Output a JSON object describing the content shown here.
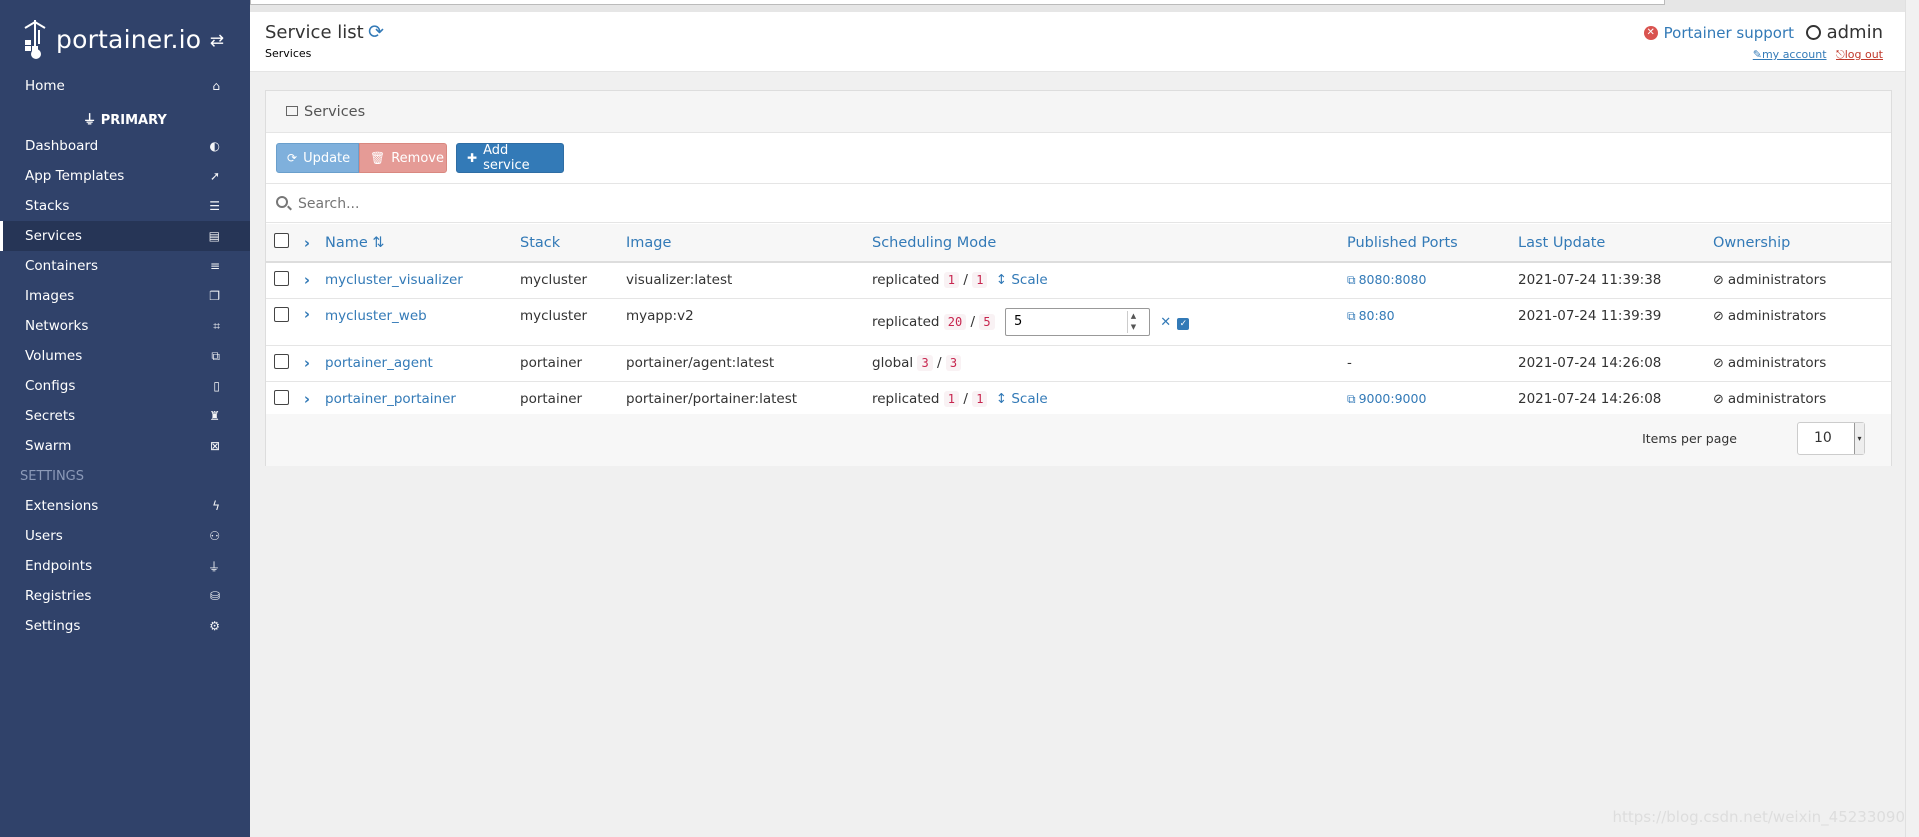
{
  "brand": {
    "name": "portainer.io"
  },
  "sidebar": {
    "home": "Home",
    "endpoint_heading": "PRIMARY",
    "items": [
      {
        "label": "Dashboard",
        "icon": "tachometer-icon"
      },
      {
        "label": "App Templates",
        "icon": "rocket-icon"
      },
      {
        "label": "Stacks",
        "icon": "th-list-icon"
      },
      {
        "label": "Services",
        "icon": "list-alt-icon"
      },
      {
        "label": "Containers",
        "icon": "server-icon"
      },
      {
        "label": "Images",
        "icon": "clone-icon"
      },
      {
        "label": "Networks",
        "icon": "sitemap-icon"
      },
      {
        "label": "Volumes",
        "icon": "cubes-icon"
      },
      {
        "label": "Configs",
        "icon": "file-code-icon"
      },
      {
        "label": "Secrets",
        "icon": "user-secret-icon"
      },
      {
        "label": "Swarm",
        "icon": "object-group-icon"
      }
    ],
    "settings_heading": "SETTINGS",
    "settings_items": [
      {
        "label": "Extensions",
        "icon": "bolt-icon"
      },
      {
        "label": "Users",
        "icon": "users-icon"
      },
      {
        "label": "Endpoints",
        "icon": "plug-icon"
      },
      {
        "label": "Registries",
        "icon": "database-icon"
      },
      {
        "label": "Settings",
        "icon": "cogs-icon"
      }
    ]
  },
  "header": {
    "title": "Service list",
    "breadcrumb": "Services",
    "support": "Portainer support",
    "user": "admin",
    "my_account": "my account",
    "log_out": "log out"
  },
  "panel": {
    "title": "Services",
    "update": "Update",
    "remove": "Remove",
    "add_service": "Add service",
    "search_placeholder": "Search..."
  },
  "table": {
    "columns": [
      "Name",
      "Stack",
      "Image",
      "Scheduling Mode",
      "Published Ports",
      "Last Update",
      "Ownership"
    ],
    "rows": [
      {
        "name": "mycluster_visualizer",
        "stack": "mycluster",
        "image": "visualizer:latest",
        "mode": "replicated",
        "running": "1",
        "desired": "1",
        "scale": "Scale",
        "ports": "8080:8080",
        "last_update": "2021-07-24 11:39:38",
        "ownership": "administrators"
      },
      {
        "name": "mycluster_web",
        "stack": "mycluster",
        "image": "myapp:v2",
        "mode": "replicated",
        "running": "20",
        "desired": "5",
        "scale_value": "5",
        "ports": "80:80",
        "last_update": "2021-07-24 11:39:39",
        "ownership": "administrators"
      },
      {
        "name": "portainer_agent",
        "stack": "portainer",
        "image": "portainer/agent:latest",
        "mode": "global",
        "running": "3",
        "desired": "3",
        "ports": "-",
        "last_update": "2021-07-24 14:26:08",
        "ownership": "administrators"
      },
      {
        "name": "portainer_portainer",
        "stack": "portainer",
        "image": "portainer/portainer:latest",
        "mode": "replicated",
        "running": "1",
        "desired": "1",
        "scale": "Scale",
        "ports": "9000:9000",
        "last_update": "2021-07-24 14:26:08",
        "ownership": "administrators"
      }
    ],
    "slash": "/"
  },
  "pagination": {
    "label": "Items per page",
    "value": "10"
  },
  "watermark": "https://blog.csdn.net/weixin_45233090",
  "colors": {
    "sidebar": "#30426a",
    "accent": "#337ab7",
    "danger": "#d9534f"
  }
}
